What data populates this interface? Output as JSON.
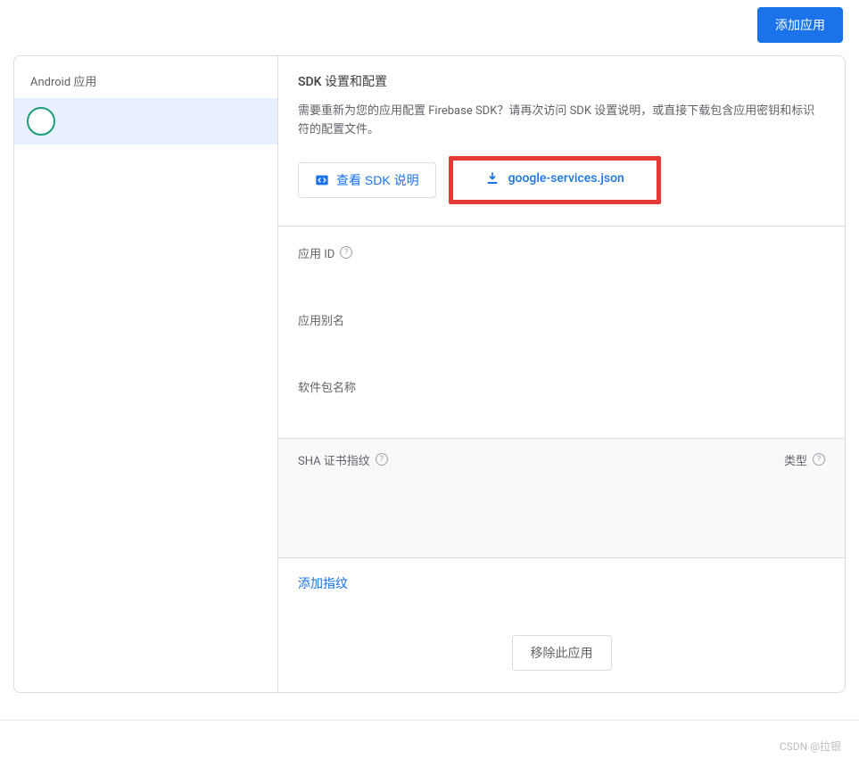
{
  "header": {
    "add_app_label": "添加应用"
  },
  "sidebar": {
    "heading": "Android 应用",
    "selected_app_name": ""
  },
  "sdk": {
    "title": "SDK 设置和配置",
    "description": "需要重新为您的应用配置 Firebase SDK？请再次访问 SDK 设置说明，或直接下载包含应用密钥和标识符的配置文件。",
    "view_sdk_label": "查看 SDK 说明",
    "download_file_label": "google-services.json"
  },
  "fields": {
    "app_id_label": "应用 ID",
    "app_id_value": "",
    "app_alias_label": "应用别名",
    "app_alias_value": "",
    "package_name_label": "软件包名称",
    "package_name_value": ""
  },
  "sha": {
    "header_label": "SHA 证书指纹",
    "type_label": "类型",
    "add_fingerprint_label": "添加指纹"
  },
  "actions": {
    "remove_app_label": "移除此应用"
  },
  "footer": {
    "credit": "CSDN @拉银"
  }
}
